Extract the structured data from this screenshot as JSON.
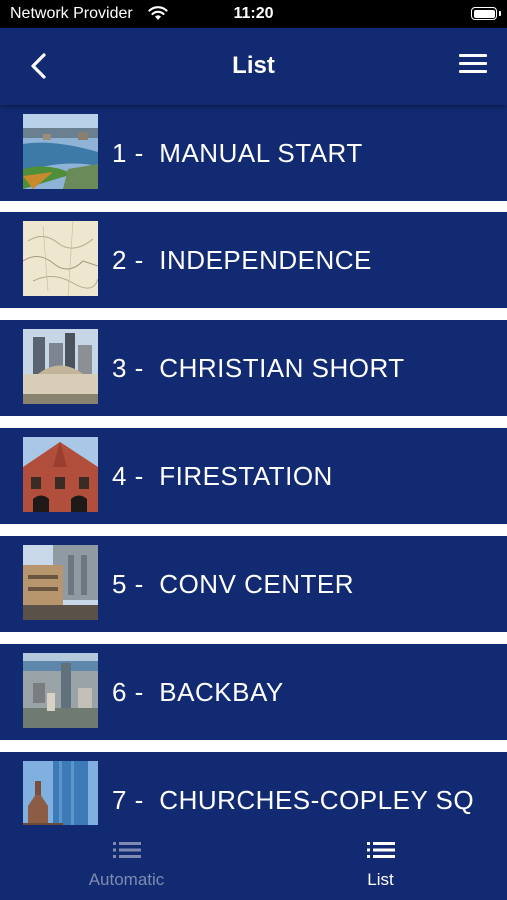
{
  "status_bar": {
    "carrier": "Network Provider",
    "time": "11:20"
  },
  "nav": {
    "title": "List",
    "back_icon": "chevron-left-icon",
    "menu_icon": "hamburger-menu-icon"
  },
  "list": {
    "items": [
      {
        "number": "1 -",
        "name": "MANUAL START"
      },
      {
        "number": "2 -",
        "name": "INDEPENDENCE"
      },
      {
        "number": "3 -",
        "name": "CHRISTIAN SHORT"
      },
      {
        "number": "4 -",
        "name": "FIRESTATION"
      },
      {
        "number": "5 -",
        "name": "CONV CENTER"
      },
      {
        "number": "6 -",
        "name": "BACKBAY"
      },
      {
        "number": "7 -",
        "name": "CHURCHES-COPLEY SQ"
      }
    ]
  },
  "tabs": [
    {
      "label": "Automatic",
      "icon": "list-icon",
      "active": false
    },
    {
      "label": "List",
      "icon": "list-icon",
      "active": true
    }
  ],
  "colors": {
    "primary": "#122a72",
    "tab_inactive": "#7e8ab0",
    "status_bar": "#000000"
  }
}
